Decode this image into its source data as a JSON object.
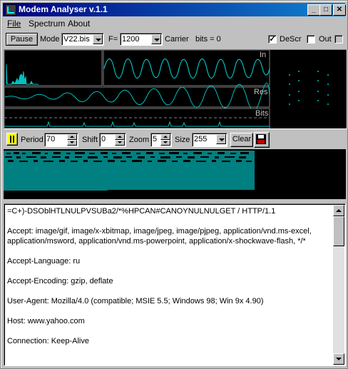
{
  "window": {
    "title": "Modem Analyser v.1.1",
    "app_icon": "modem-app-icon",
    "controls": {
      "minimize": "_",
      "maximize": "□",
      "close": "✕"
    }
  },
  "menu": {
    "file": "File",
    "spectrum": "Spectrum",
    "about": "About"
  },
  "toolbar": {
    "pause_label": "Pause",
    "mode_label": "Mode",
    "mode_value": "V22.bis",
    "freq_label": "F=",
    "freq_value": "1200",
    "carrier_label": "Carrier",
    "bits_label": "bits = 0",
    "descr_label": "DeScr",
    "descr_checked": "✓",
    "out_label": "Out"
  },
  "scopes": {
    "in_label": "In",
    "res_label": "Res",
    "bits_label": "Bits",
    "trace_color": "#00c0c0"
  },
  "bitmap_bar": {
    "period_label": "Period",
    "period_value": "70",
    "shift_label": "Shift",
    "shift_value": "0",
    "zoom_label": "Zoom",
    "zoom_value": "5",
    "size_label": "Size",
    "size_value": "255",
    "clear_label": "Clear",
    "pause_icon": "pause-bars-icon",
    "save_icon": "floppy-disk-icon",
    "bitmap_color": "#008080"
  },
  "output": {
    "lines": [
      "=C+)-DSOblHTLNULPVSUBa2/*%HPCAN#CANOYNULNULGET / HTTP/1.1",
      "",
      "Accept: image/gif, image/x-xbitmap, image/jpeg, image/pjpeg, application/vnd.ms-excel,",
      "application/msword, application/vnd.ms-powerpoint, application/x-shockwave-flash, */*",
      "",
      "Accept-Language: ru",
      "",
      "Accept-Encoding: gzip, deflate",
      "",
      "User-Agent: Mozilla/4.0 (compatible; MSIE 5.5; Windows 98; Win 9x 4.90)",
      "",
      "Host: www.yahoo.com",
      "",
      "Connection: Keep-Alive"
    ]
  }
}
